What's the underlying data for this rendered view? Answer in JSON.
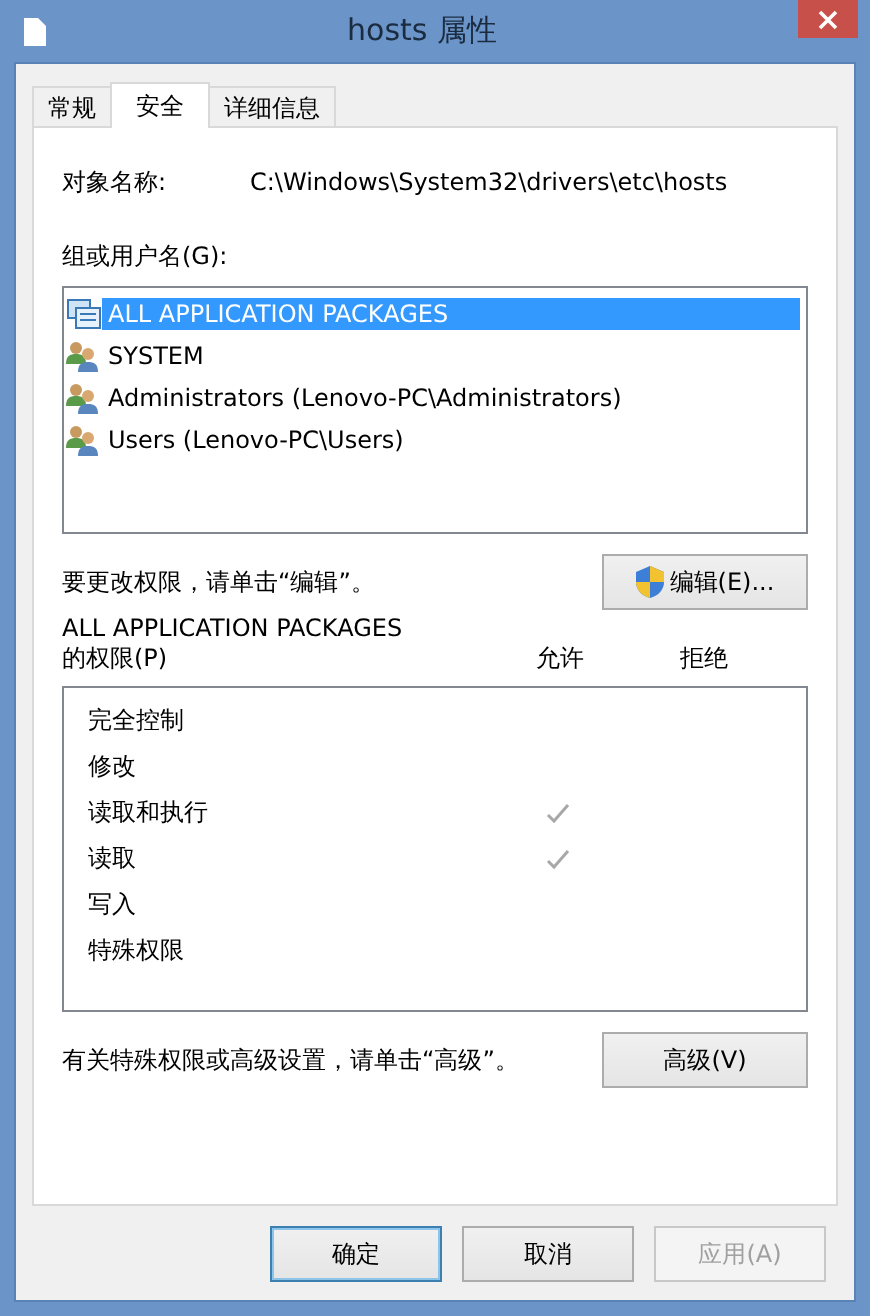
{
  "window": {
    "title": "hosts 属性"
  },
  "tabs": [
    {
      "label": "常规",
      "selected": false
    },
    {
      "label": "安全",
      "selected": true
    },
    {
      "label": "详细信息",
      "selected": false
    }
  ],
  "object_name": {
    "label": "对象名称:",
    "value": "C:\\Windows\\System32\\drivers\\etc\\hosts"
  },
  "groups": {
    "label": "组或用户名(G):",
    "items": [
      {
        "name": "ALL APPLICATION PACKAGES",
        "kind": "package",
        "selected": true
      },
      {
        "name": "SYSTEM",
        "kind": "group",
        "selected": false
      },
      {
        "name": "Administrators (Lenovo-PC\\Administrators)",
        "kind": "group",
        "selected": false
      },
      {
        "name": "Users (Lenovo-PC\\Users)",
        "kind": "group",
        "selected": false
      }
    ]
  },
  "edit_hint": "要更改权限，请单击“编辑”。",
  "edit_button": "编辑(E)...",
  "permissions": {
    "title": "ALL APPLICATION PACKAGES",
    "label": "的权限(P)",
    "columns": [
      "允许",
      "拒绝"
    ],
    "rows": [
      {
        "name": "完全控制",
        "allow": false,
        "deny": false
      },
      {
        "name": "修改",
        "allow": false,
        "deny": false
      },
      {
        "name": "读取和执行",
        "allow": true,
        "deny": false
      },
      {
        "name": "读取",
        "allow": true,
        "deny": false
      },
      {
        "name": "写入",
        "allow": false,
        "deny": false
      },
      {
        "name": "特殊权限",
        "allow": false,
        "deny": false
      }
    ]
  },
  "advanced_hint": "有关特殊权限或高级设置，请单击“高级”。",
  "advanced_button": "高级(V)",
  "buttons": [
    {
      "label": "确定",
      "default": true,
      "disabled": false
    },
    {
      "label": "取消",
      "default": false,
      "disabled": false
    },
    {
      "label": "应用(A)",
      "default": false,
      "disabled": true
    }
  ]
}
